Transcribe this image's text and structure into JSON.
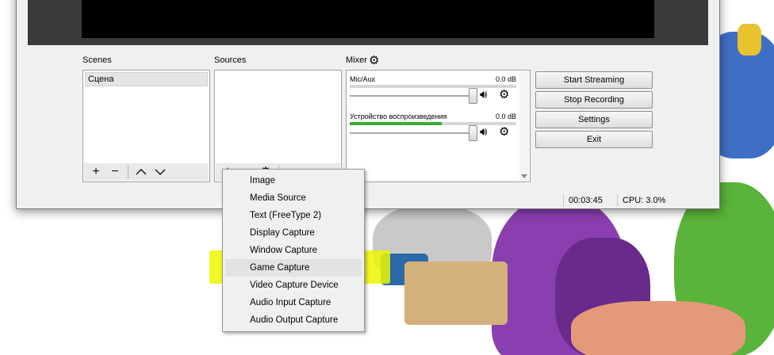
{
  "panels": {
    "scenes": {
      "label": "Scenes",
      "items": [
        "Сцена"
      ]
    },
    "sources": {
      "label": "Sources"
    },
    "mixer": {
      "label": "Mixer",
      "channels": [
        {
          "name": "Mic/Aux",
          "db": "0.0 dB",
          "level": 0.0
        },
        {
          "name": "Устройство воспроизведения",
          "db": "0.0 dB",
          "level": 0.55
        }
      ]
    }
  },
  "buttons": {
    "start_streaming": "Start Streaming",
    "stop_recording": "Stop Recording",
    "settings": "Settings",
    "exit": "Exit"
  },
  "status": {
    "time": "00:03:45",
    "cpu": "CPU: 3.0%"
  },
  "context_menu": {
    "items": [
      "Image",
      "Media Source",
      "Text (FreeType 2)",
      "Display Capture",
      "Window Capture",
      "Game Capture",
      "Video Capture Device",
      "Audio Input Capture",
      "Audio Output Capture"
    ],
    "highlighted": "Game Capture"
  },
  "colors": {
    "highlight": "#ecf600",
    "meter": "#3aaa35"
  }
}
